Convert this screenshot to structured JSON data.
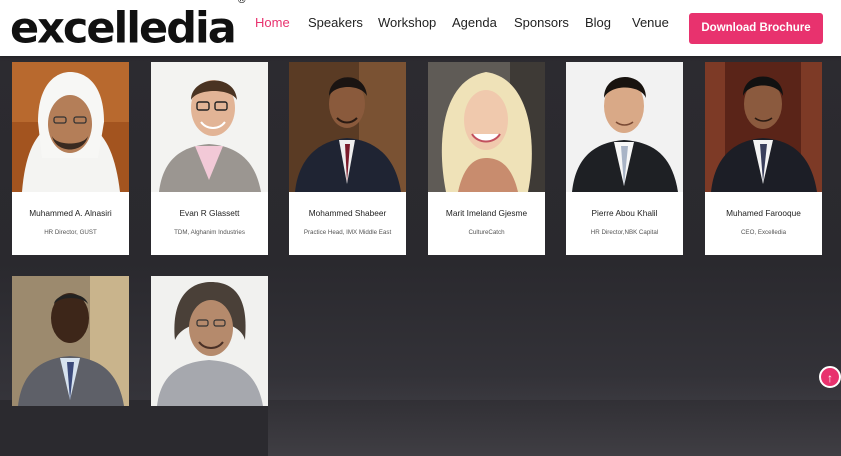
{
  "brand": {
    "logo_text": "excelledia",
    "registered_mark": "®"
  },
  "nav": {
    "items": [
      {
        "label": "Home",
        "active": true
      },
      {
        "label": "Speakers",
        "active": false
      },
      {
        "label": "Workshop",
        "active": false
      },
      {
        "label": "Agenda",
        "active": false
      },
      {
        "label": "Sponsors",
        "active": false
      },
      {
        "label": "Blog",
        "active": false
      },
      {
        "label": "Venue",
        "active": false
      }
    ],
    "cta_label": "Download Brochure"
  },
  "colors": {
    "accent": "#e8326e",
    "background": "#2b2a2f",
    "card": "#ffffff"
  },
  "speakers": [
    {
      "name": "Muhammed A. Alnasiri",
      "role": "HR Director, GUST"
    },
    {
      "name": "Evan R Glassett",
      "role": "TDM, Alghanim Industries"
    },
    {
      "name": "Mohammed Shabeer",
      "role": "Practice Head, IMX Middle East"
    },
    {
      "name": "Marit Imeland Gjesme",
      "role": "CultureCatch"
    },
    {
      "name": "Pierre Abou Khalil",
      "role": "HR Director,NBK Capital"
    },
    {
      "name": "Muhamed Farooque",
      "role": "CEO, Excelledia"
    },
    {
      "name": "",
      "role": ""
    },
    {
      "name": "",
      "role": ""
    }
  ],
  "scroll_top_icon": "arrow-up-icon"
}
